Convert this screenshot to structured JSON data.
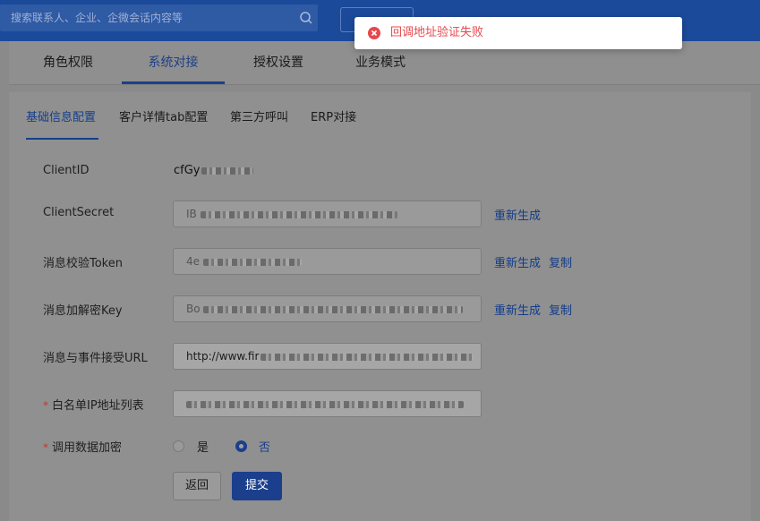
{
  "search": {
    "placeholder": "搜索联系人、企业、企微会话内容等"
  },
  "toast": {
    "message": "回调地址验证失败",
    "color": "#e5484d"
  },
  "tabs": [
    {
      "label": "角色权限"
    },
    {
      "label": "系统对接",
      "active": true
    },
    {
      "label": "授权设置"
    },
    {
      "label": "业务模式"
    }
  ],
  "subtabs": [
    {
      "label": "基础信息配置",
      "active": true
    },
    {
      "label": "客户详情tab配置"
    },
    {
      "label": "第三方呼叫"
    },
    {
      "label": "ERP对接"
    }
  ],
  "form": {
    "client_id": {
      "label": "ClientID",
      "value_prefix": "cfGy"
    },
    "client_secret": {
      "label": "ClientSecret",
      "value_prefix": "IB",
      "regenerate": "重新生成"
    },
    "token": {
      "label": "消息校验Token",
      "value_prefix": "4e",
      "regenerate": "重新生成",
      "copy": "复制"
    },
    "aes_key": {
      "label": "消息加解密Key",
      "value_prefix": "Bo",
      "regenerate": "重新生成",
      "copy": "复制"
    },
    "callback_url": {
      "label": "消息与事件接受URL",
      "value_prefix": "http://www.fir"
    },
    "ip_whitelist": {
      "label": "白名单IP地址列表",
      "required_mark": "*"
    },
    "encryption": {
      "label": "调用数据加密",
      "required_mark": "*",
      "options": [
        {
          "label": "是",
          "checked": false
        },
        {
          "label": "否",
          "checked": true
        }
      ]
    }
  },
  "buttons": {
    "back": "返回",
    "submit": "提交"
  },
  "colors": {
    "topbar": "#1c4a9a",
    "accent": "#1b3f8c",
    "error": "#e5484d"
  }
}
